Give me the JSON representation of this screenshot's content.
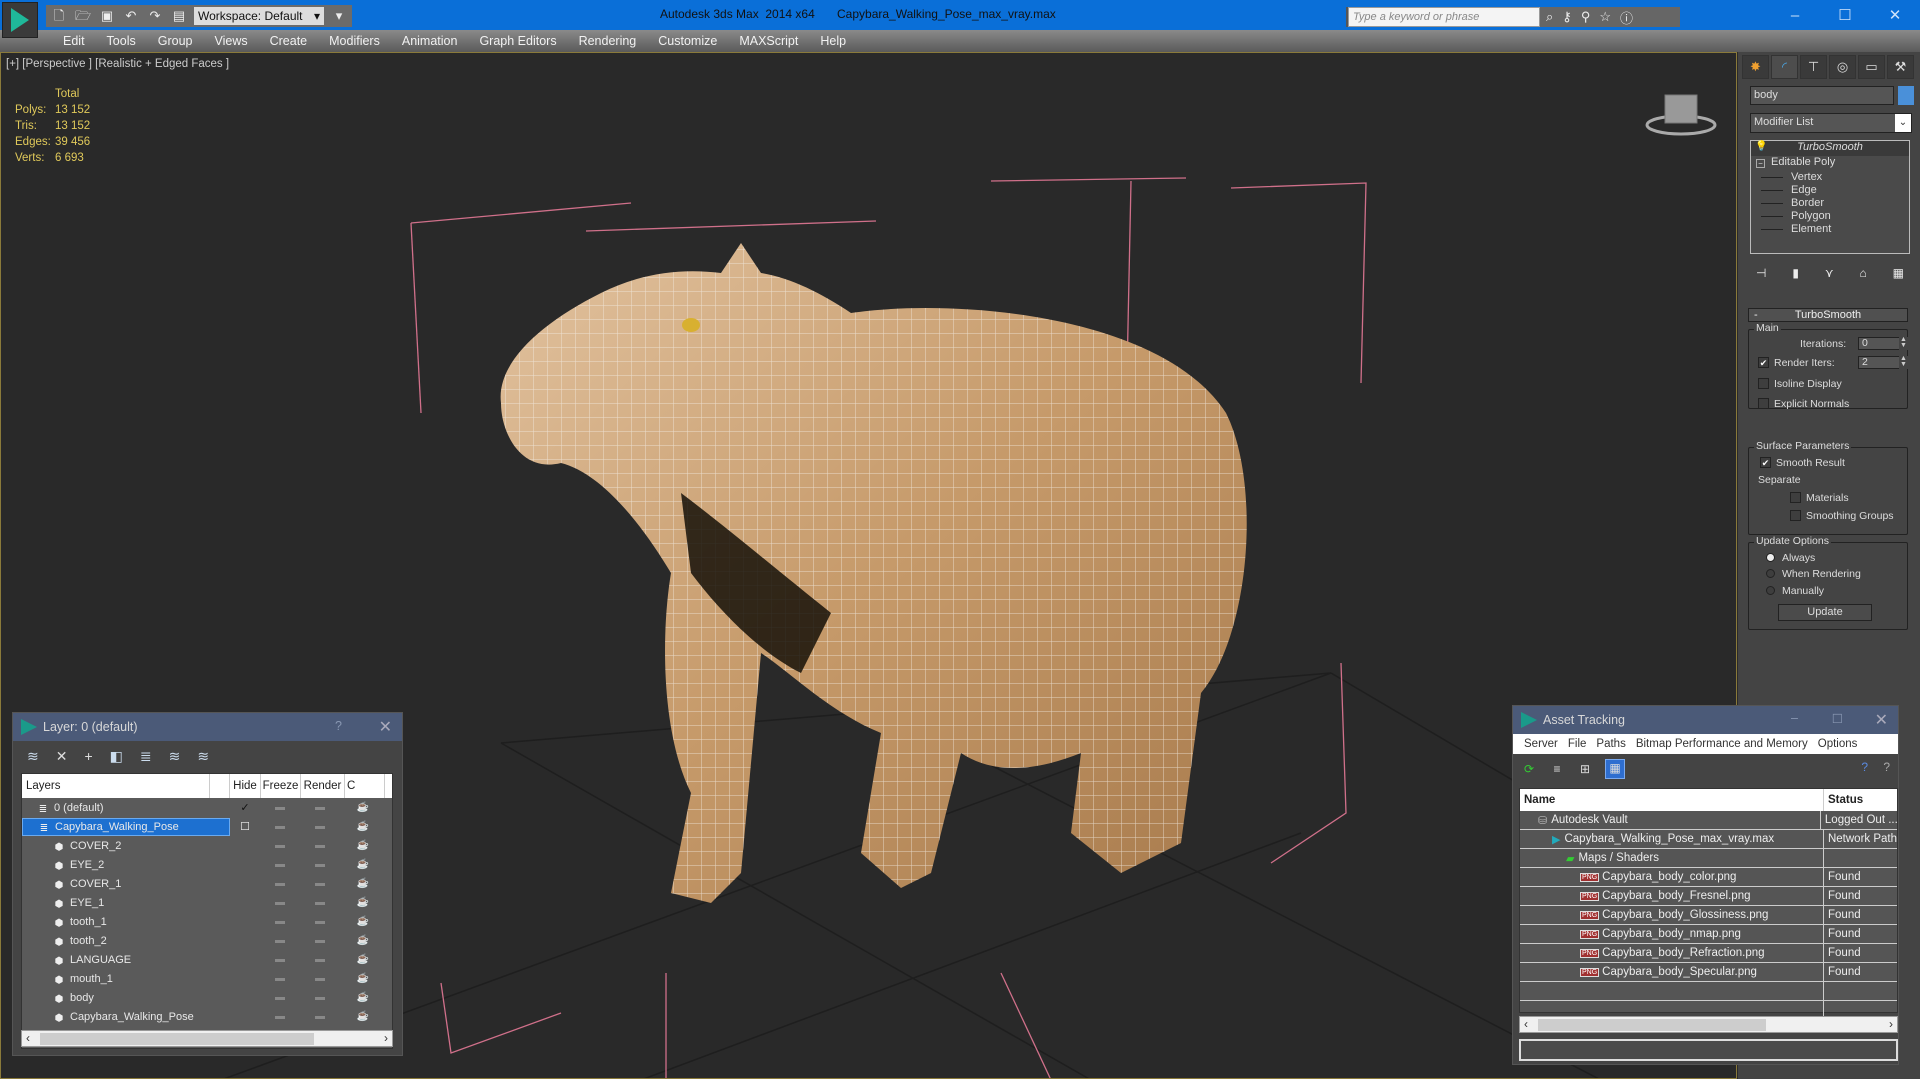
{
  "titlebar": {
    "app_title": "Autodesk 3ds Max  2014 x64",
    "file_name": "Capybara_Walking_Pose_max_vray.max",
    "workspace": "Workspace: Default",
    "search_placeholder": "Type a keyword or phrase",
    "window_controls": [
      "minimize",
      "maximize",
      "close"
    ]
  },
  "menu": [
    "Edit",
    "Tools",
    "Group",
    "Views",
    "Create",
    "Modifiers",
    "Animation",
    "Graph Editors",
    "Rendering",
    "Customize",
    "MAXScript",
    "Help"
  ],
  "viewport": {
    "label": "[+] [Perspective ] [Realistic + Edged Faces ]",
    "stats": {
      "header": "Total",
      "rows": [
        {
          "key": "Polys:",
          "value": "13 152"
        },
        {
          "key": "Tris:",
          "value": "13 152"
        },
        {
          "key": "Edges:",
          "value": "39 456"
        },
        {
          "key": "Verts:",
          "value": "6 693"
        }
      ]
    },
    "stats_color": "#e0c95a"
  },
  "command_panel": {
    "object_name": "body",
    "object_color": "#4a90d9",
    "modifier_list": "Modifier List",
    "stack": {
      "top": "TurboSmooth",
      "base": "Editable Poly",
      "subobjects": [
        "Vertex",
        "Edge",
        "Border",
        "Polygon",
        "Element"
      ]
    },
    "rollout": {
      "title": "TurboSmooth",
      "main_group": "Main",
      "iterations_label": "Iterations:",
      "iterations_value": "0",
      "render_iters_label": "Render Iters:",
      "render_iters_value": "2",
      "render_iters_checked": true,
      "isoline_display": "Isoline Display",
      "explicit_normals": "Explicit Normals",
      "surface_group": "Surface Parameters",
      "smooth_result": "Smooth Result",
      "separate": "Separate",
      "materials": "Materials",
      "smoothing_groups": "Smoothing Groups",
      "update_group": "Update Options",
      "update_options": [
        "Always",
        "When Rendering",
        "Manually"
      ],
      "update_selected": "Always",
      "update_button": "Update"
    }
  },
  "layer_dialog": {
    "title": "Layer: 0 (default)",
    "help": "?",
    "columns": [
      "Layers",
      "",
      "Hide",
      "Freeze",
      "Render",
      "C"
    ],
    "layers": [
      {
        "name": "0 (default)",
        "type": "layer",
        "current": true
      },
      {
        "name": "Capybara_Walking_Pose",
        "type": "layer",
        "selected": true
      },
      {
        "name": "COVER_2",
        "type": "object"
      },
      {
        "name": "EYE_2",
        "type": "object"
      },
      {
        "name": "COVER_1",
        "type": "object"
      },
      {
        "name": "EYE_1",
        "type": "object"
      },
      {
        "name": "tooth_1",
        "type": "object"
      },
      {
        "name": "tooth_2",
        "type": "object"
      },
      {
        "name": "LANGUAGE",
        "type": "object"
      },
      {
        "name": "mouth_1",
        "type": "object"
      },
      {
        "name": "body",
        "type": "object"
      },
      {
        "name": "Capybara_Walking_Pose",
        "type": "object"
      }
    ]
  },
  "asset_tracking": {
    "title": "Asset Tracking",
    "menu": [
      "Server",
      "File",
      "Paths",
      "Bitmap Performance and Memory",
      "Options"
    ],
    "columns": [
      "Name",
      "Status"
    ],
    "rows": [
      {
        "name": "Autodesk Vault",
        "status": "Logged Out ...",
        "indent": 1,
        "icon": "vault"
      },
      {
        "name": "Capybara_Walking_Pose_max_vray.max",
        "status": "Network Path",
        "indent": 2,
        "icon": "max"
      },
      {
        "name": "Maps / Shaders",
        "status": "",
        "indent": 3,
        "icon": "maps"
      },
      {
        "name": "Capybara_body_color.png",
        "status": "Found",
        "indent": 4,
        "icon": "png"
      },
      {
        "name": "Capybara_body_Fresnel.png",
        "status": "Found",
        "indent": 4,
        "icon": "png"
      },
      {
        "name": "Capybara_body_Glossiness.png",
        "status": "Found",
        "indent": 4,
        "icon": "png"
      },
      {
        "name": "Capybara_body_nmap.png",
        "status": "Found",
        "indent": 4,
        "icon": "png"
      },
      {
        "name": "Capybara_body_Refraction.png",
        "status": "Found",
        "indent": 4,
        "icon": "png"
      },
      {
        "name": "Capybara_body_Specular.png",
        "status": "Found",
        "indent": 4,
        "icon": "png"
      }
    ]
  }
}
